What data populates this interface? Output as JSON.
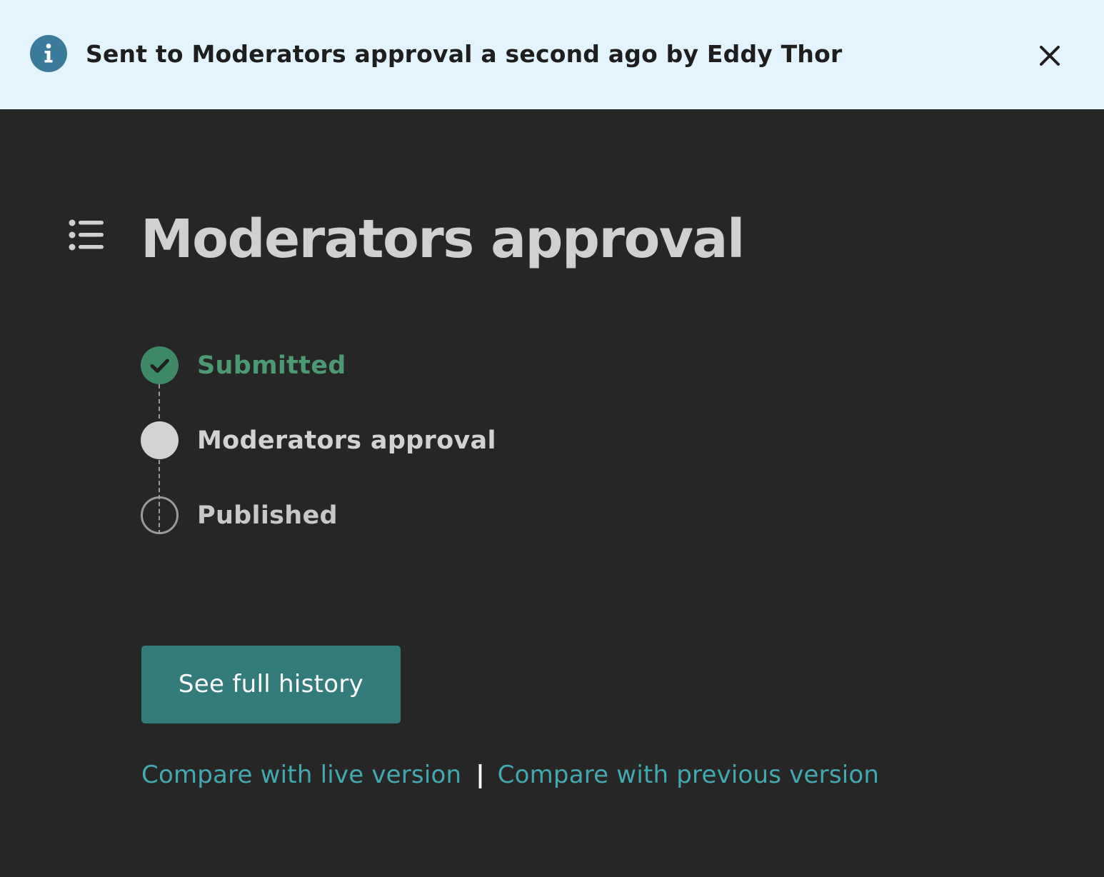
{
  "notification": {
    "icon": "info-icon",
    "message": "Sent to Moderators approval a second ago by Eddy Thor",
    "close_icon": "close-icon",
    "background": "#e4f4fc",
    "icon_color": "#3b7a9b"
  },
  "header": {
    "icon": "list-icon",
    "title": "Moderators approval"
  },
  "workflow": {
    "steps": [
      {
        "label": "Submitted",
        "status": "complete",
        "icon": "checkmark-icon",
        "color": "#3f8a66"
      },
      {
        "label": "Moderators approval",
        "status": "current",
        "color": "#d2d2d2"
      },
      {
        "label": "Published",
        "status": "pending",
        "color": "#9a9a9a"
      }
    ]
  },
  "actions": {
    "history_button": "See full history",
    "button_color": "#347b7c",
    "compare_live": "Compare with live version",
    "separator": "|",
    "compare_previous": "Compare with previous version",
    "link_color": "#43a9b0"
  }
}
